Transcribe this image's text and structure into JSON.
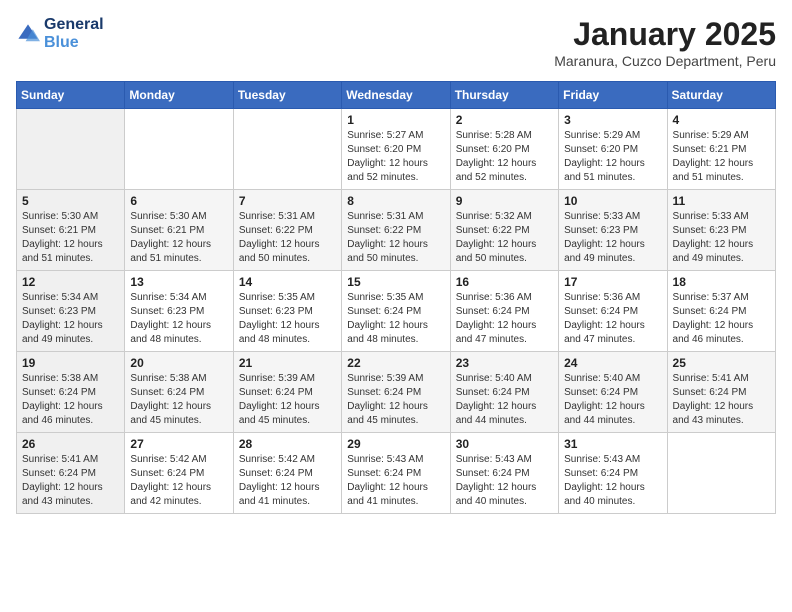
{
  "logo": {
    "text_general": "General",
    "text_blue": "Blue"
  },
  "header": {
    "month": "January 2025",
    "location": "Maranura, Cuzco Department, Peru"
  },
  "weekdays": [
    "Sunday",
    "Monday",
    "Tuesday",
    "Wednesday",
    "Thursday",
    "Friday",
    "Saturday"
  ],
  "weeks": [
    [
      {
        "day": "",
        "info": ""
      },
      {
        "day": "",
        "info": ""
      },
      {
        "day": "",
        "info": ""
      },
      {
        "day": "1",
        "info": "Sunrise: 5:27 AM\nSunset: 6:20 PM\nDaylight: 12 hours\nand 52 minutes."
      },
      {
        "day": "2",
        "info": "Sunrise: 5:28 AM\nSunset: 6:20 PM\nDaylight: 12 hours\nand 52 minutes."
      },
      {
        "day": "3",
        "info": "Sunrise: 5:29 AM\nSunset: 6:20 PM\nDaylight: 12 hours\nand 51 minutes."
      },
      {
        "day": "4",
        "info": "Sunrise: 5:29 AM\nSunset: 6:21 PM\nDaylight: 12 hours\nand 51 minutes."
      }
    ],
    [
      {
        "day": "5",
        "info": "Sunrise: 5:30 AM\nSunset: 6:21 PM\nDaylight: 12 hours\nand 51 minutes."
      },
      {
        "day": "6",
        "info": "Sunrise: 5:30 AM\nSunset: 6:21 PM\nDaylight: 12 hours\nand 51 minutes."
      },
      {
        "day": "7",
        "info": "Sunrise: 5:31 AM\nSunset: 6:22 PM\nDaylight: 12 hours\nand 50 minutes."
      },
      {
        "day": "8",
        "info": "Sunrise: 5:31 AM\nSunset: 6:22 PM\nDaylight: 12 hours\nand 50 minutes."
      },
      {
        "day": "9",
        "info": "Sunrise: 5:32 AM\nSunset: 6:22 PM\nDaylight: 12 hours\nand 50 minutes."
      },
      {
        "day": "10",
        "info": "Sunrise: 5:33 AM\nSunset: 6:23 PM\nDaylight: 12 hours\nand 49 minutes."
      },
      {
        "day": "11",
        "info": "Sunrise: 5:33 AM\nSunset: 6:23 PM\nDaylight: 12 hours\nand 49 minutes."
      }
    ],
    [
      {
        "day": "12",
        "info": "Sunrise: 5:34 AM\nSunset: 6:23 PM\nDaylight: 12 hours\nand 49 minutes."
      },
      {
        "day": "13",
        "info": "Sunrise: 5:34 AM\nSunset: 6:23 PM\nDaylight: 12 hours\nand 48 minutes."
      },
      {
        "day": "14",
        "info": "Sunrise: 5:35 AM\nSunset: 6:23 PM\nDaylight: 12 hours\nand 48 minutes."
      },
      {
        "day": "15",
        "info": "Sunrise: 5:35 AM\nSunset: 6:24 PM\nDaylight: 12 hours\nand 48 minutes."
      },
      {
        "day": "16",
        "info": "Sunrise: 5:36 AM\nSunset: 6:24 PM\nDaylight: 12 hours\nand 47 minutes."
      },
      {
        "day": "17",
        "info": "Sunrise: 5:36 AM\nSunset: 6:24 PM\nDaylight: 12 hours\nand 47 minutes."
      },
      {
        "day": "18",
        "info": "Sunrise: 5:37 AM\nSunset: 6:24 PM\nDaylight: 12 hours\nand 46 minutes."
      }
    ],
    [
      {
        "day": "19",
        "info": "Sunrise: 5:38 AM\nSunset: 6:24 PM\nDaylight: 12 hours\nand 46 minutes."
      },
      {
        "day": "20",
        "info": "Sunrise: 5:38 AM\nSunset: 6:24 PM\nDaylight: 12 hours\nand 45 minutes."
      },
      {
        "day": "21",
        "info": "Sunrise: 5:39 AM\nSunset: 6:24 PM\nDaylight: 12 hours\nand 45 minutes."
      },
      {
        "day": "22",
        "info": "Sunrise: 5:39 AM\nSunset: 6:24 PM\nDaylight: 12 hours\nand 45 minutes."
      },
      {
        "day": "23",
        "info": "Sunrise: 5:40 AM\nSunset: 6:24 PM\nDaylight: 12 hours\nand 44 minutes."
      },
      {
        "day": "24",
        "info": "Sunrise: 5:40 AM\nSunset: 6:24 PM\nDaylight: 12 hours\nand 44 minutes."
      },
      {
        "day": "25",
        "info": "Sunrise: 5:41 AM\nSunset: 6:24 PM\nDaylight: 12 hours\nand 43 minutes."
      }
    ],
    [
      {
        "day": "26",
        "info": "Sunrise: 5:41 AM\nSunset: 6:24 PM\nDaylight: 12 hours\nand 43 minutes."
      },
      {
        "day": "27",
        "info": "Sunrise: 5:42 AM\nSunset: 6:24 PM\nDaylight: 12 hours\nand 42 minutes."
      },
      {
        "day": "28",
        "info": "Sunrise: 5:42 AM\nSunset: 6:24 PM\nDaylight: 12 hours\nand 41 minutes."
      },
      {
        "day": "29",
        "info": "Sunrise: 5:43 AM\nSunset: 6:24 PM\nDaylight: 12 hours\nand 41 minutes."
      },
      {
        "day": "30",
        "info": "Sunrise: 5:43 AM\nSunset: 6:24 PM\nDaylight: 12 hours\nand 40 minutes."
      },
      {
        "day": "31",
        "info": "Sunrise: 5:43 AM\nSunset: 6:24 PM\nDaylight: 12 hours\nand 40 minutes."
      },
      {
        "day": "",
        "info": ""
      }
    ]
  ]
}
